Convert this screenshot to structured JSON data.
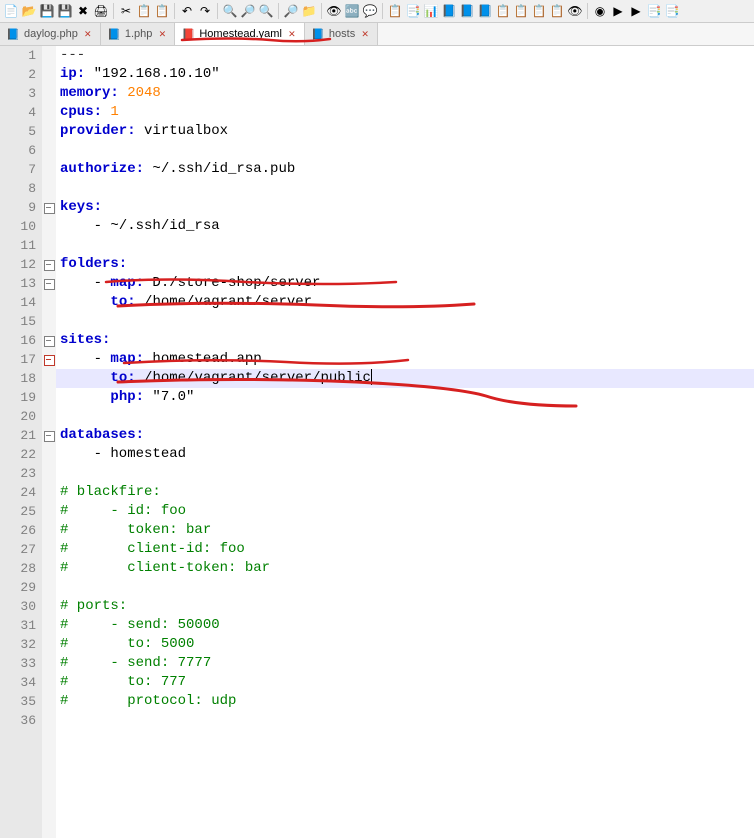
{
  "toolbar": {
    "icons": [
      "📄",
      "📂",
      "💾",
      "💾",
      "✖",
      "🖨",
      " ",
      "✂",
      "📋",
      "📋",
      " ",
      "↶",
      "↷",
      " ",
      "🔍",
      "🔎",
      "🔍",
      " ",
      "🔎",
      "📁",
      " ",
      "👁",
      "🔤",
      "💬",
      " ",
      "📋",
      "📑",
      "📊",
      "📘",
      "📘",
      "📘",
      "📋",
      "📋",
      "📋",
      "📋",
      "👁",
      " ",
      "◉",
      "▶",
      "▶",
      "📑",
      "📑"
    ]
  },
  "tabs": [
    {
      "icon": "📘",
      "label": "daylog.php",
      "active": false
    },
    {
      "icon": "📘",
      "label": "1.php",
      "active": false
    },
    {
      "icon": "📕",
      "label": "Homestead.yaml",
      "active": true
    },
    {
      "icon": "📘",
      "label": "hosts",
      "active": false
    }
  ],
  "lines": [
    {
      "num": 1,
      "code": [
        {
          "t": "---",
          "c": "k-str"
        }
      ]
    },
    {
      "num": 2,
      "code": [
        {
          "t": "ip:",
          "c": "k-key"
        },
        {
          "t": " \"192.168.10.10\"",
          "c": "k-plain"
        }
      ]
    },
    {
      "num": 3,
      "code": [
        {
          "t": "memory:",
          "c": "k-key"
        },
        {
          "t": " ",
          "c": ""
        },
        {
          "t": "2048",
          "c": "k-num"
        }
      ]
    },
    {
      "num": 4,
      "code": [
        {
          "t": "cpus:",
          "c": "k-key"
        },
        {
          "t": " ",
          "c": ""
        },
        {
          "t": "1",
          "c": "k-num"
        }
      ]
    },
    {
      "num": 5,
      "code": [
        {
          "t": "provider:",
          "c": "k-key"
        },
        {
          "t": " virtualbox",
          "c": "k-plain"
        }
      ]
    },
    {
      "num": 6,
      "code": []
    },
    {
      "num": 7,
      "code": [
        {
          "t": "authorize:",
          "c": "k-key"
        },
        {
          "t": " ~/.ssh/id_rsa.pub",
          "c": "k-plain"
        }
      ]
    },
    {
      "num": 8,
      "code": []
    },
    {
      "num": 9,
      "fold": "minus",
      "code": [
        {
          "t": "keys:",
          "c": "k-key"
        }
      ]
    },
    {
      "num": 10,
      "code": [
        {
          "t": "    - ~/.ssh/id_rsa",
          "c": "k-plain"
        }
      ]
    },
    {
      "num": 11,
      "code": []
    },
    {
      "num": 12,
      "fold": "minus",
      "code": [
        {
          "t": "folders:",
          "c": "k-key"
        }
      ]
    },
    {
      "num": 13,
      "fold": "minus",
      "code": [
        {
          "t": "    - ",
          "c": "k-plain"
        },
        {
          "t": "map:",
          "c": "k-key"
        },
        {
          "t": " D:/store-shop/server",
          "c": "k-plain"
        }
      ]
    },
    {
      "num": 14,
      "code": [
        {
          "t": "      ",
          "c": ""
        },
        {
          "t": "to:",
          "c": "k-key"
        },
        {
          "t": " /home/vagrant/server",
          "c": "k-plain"
        }
      ]
    },
    {
      "num": 15,
      "code": []
    },
    {
      "num": 16,
      "fold": "minus",
      "code": [
        {
          "t": "sites:",
          "c": "k-key"
        }
      ]
    },
    {
      "num": 17,
      "fold": "redbox",
      "code": [
        {
          "t": "    - ",
          "c": "k-plain"
        },
        {
          "t": "map:",
          "c": "k-key"
        },
        {
          "t": " homestead.app",
          "c": "k-plain"
        }
      ]
    },
    {
      "num": 18,
      "hl": true,
      "code": [
        {
          "t": "      ",
          "c": ""
        },
        {
          "t": "to:",
          "c": "k-key"
        },
        {
          "t": " /home/vagrant/server/public",
          "c": "k-plain"
        }
      ]
    },
    {
      "num": 19,
      "code": [
        {
          "t": "      ",
          "c": ""
        },
        {
          "t": "php:",
          "c": "k-key"
        },
        {
          "t": " \"7.0\"",
          "c": "k-plain"
        }
      ]
    },
    {
      "num": 20,
      "code": []
    },
    {
      "num": 21,
      "fold": "minus",
      "code": [
        {
          "t": "databases:",
          "c": "k-key"
        }
      ]
    },
    {
      "num": 22,
      "code": [
        {
          "t": "    - homestead",
          "c": "k-plain"
        }
      ]
    },
    {
      "num": 23,
      "code": []
    },
    {
      "num": 24,
      "code": [
        {
          "t": "# blackfire:",
          "c": "k-cmt"
        }
      ]
    },
    {
      "num": 25,
      "code": [
        {
          "t": "#     - id: foo",
          "c": "k-cmt"
        }
      ]
    },
    {
      "num": 26,
      "code": [
        {
          "t": "#       token: bar",
          "c": "k-cmt"
        }
      ]
    },
    {
      "num": 27,
      "code": [
        {
          "t": "#       client-id: foo",
          "c": "k-cmt"
        }
      ]
    },
    {
      "num": 28,
      "code": [
        {
          "t": "#       client-token: bar",
          "c": "k-cmt"
        }
      ]
    },
    {
      "num": 29,
      "code": []
    },
    {
      "num": 30,
      "code": [
        {
          "t": "# ports:",
          "c": "k-cmt"
        }
      ]
    },
    {
      "num": 31,
      "code": [
        {
          "t": "#     - send: 50000",
          "c": "k-cmt"
        }
      ]
    },
    {
      "num": 32,
      "code": [
        {
          "t": "#       to: 5000",
          "c": "k-cmt"
        }
      ]
    },
    {
      "num": 33,
      "code": [
        {
          "t": "#     - send: 7777",
          "c": "k-cmt"
        }
      ]
    },
    {
      "num": 34,
      "code": [
        {
          "t": "#       to: 777",
          "c": "k-cmt"
        }
      ]
    },
    {
      "num": 35,
      "code": [
        {
          "t": "#       protocol: udp",
          "c": "k-cmt"
        }
      ]
    },
    {
      "num": 36,
      "code": []
    }
  ]
}
